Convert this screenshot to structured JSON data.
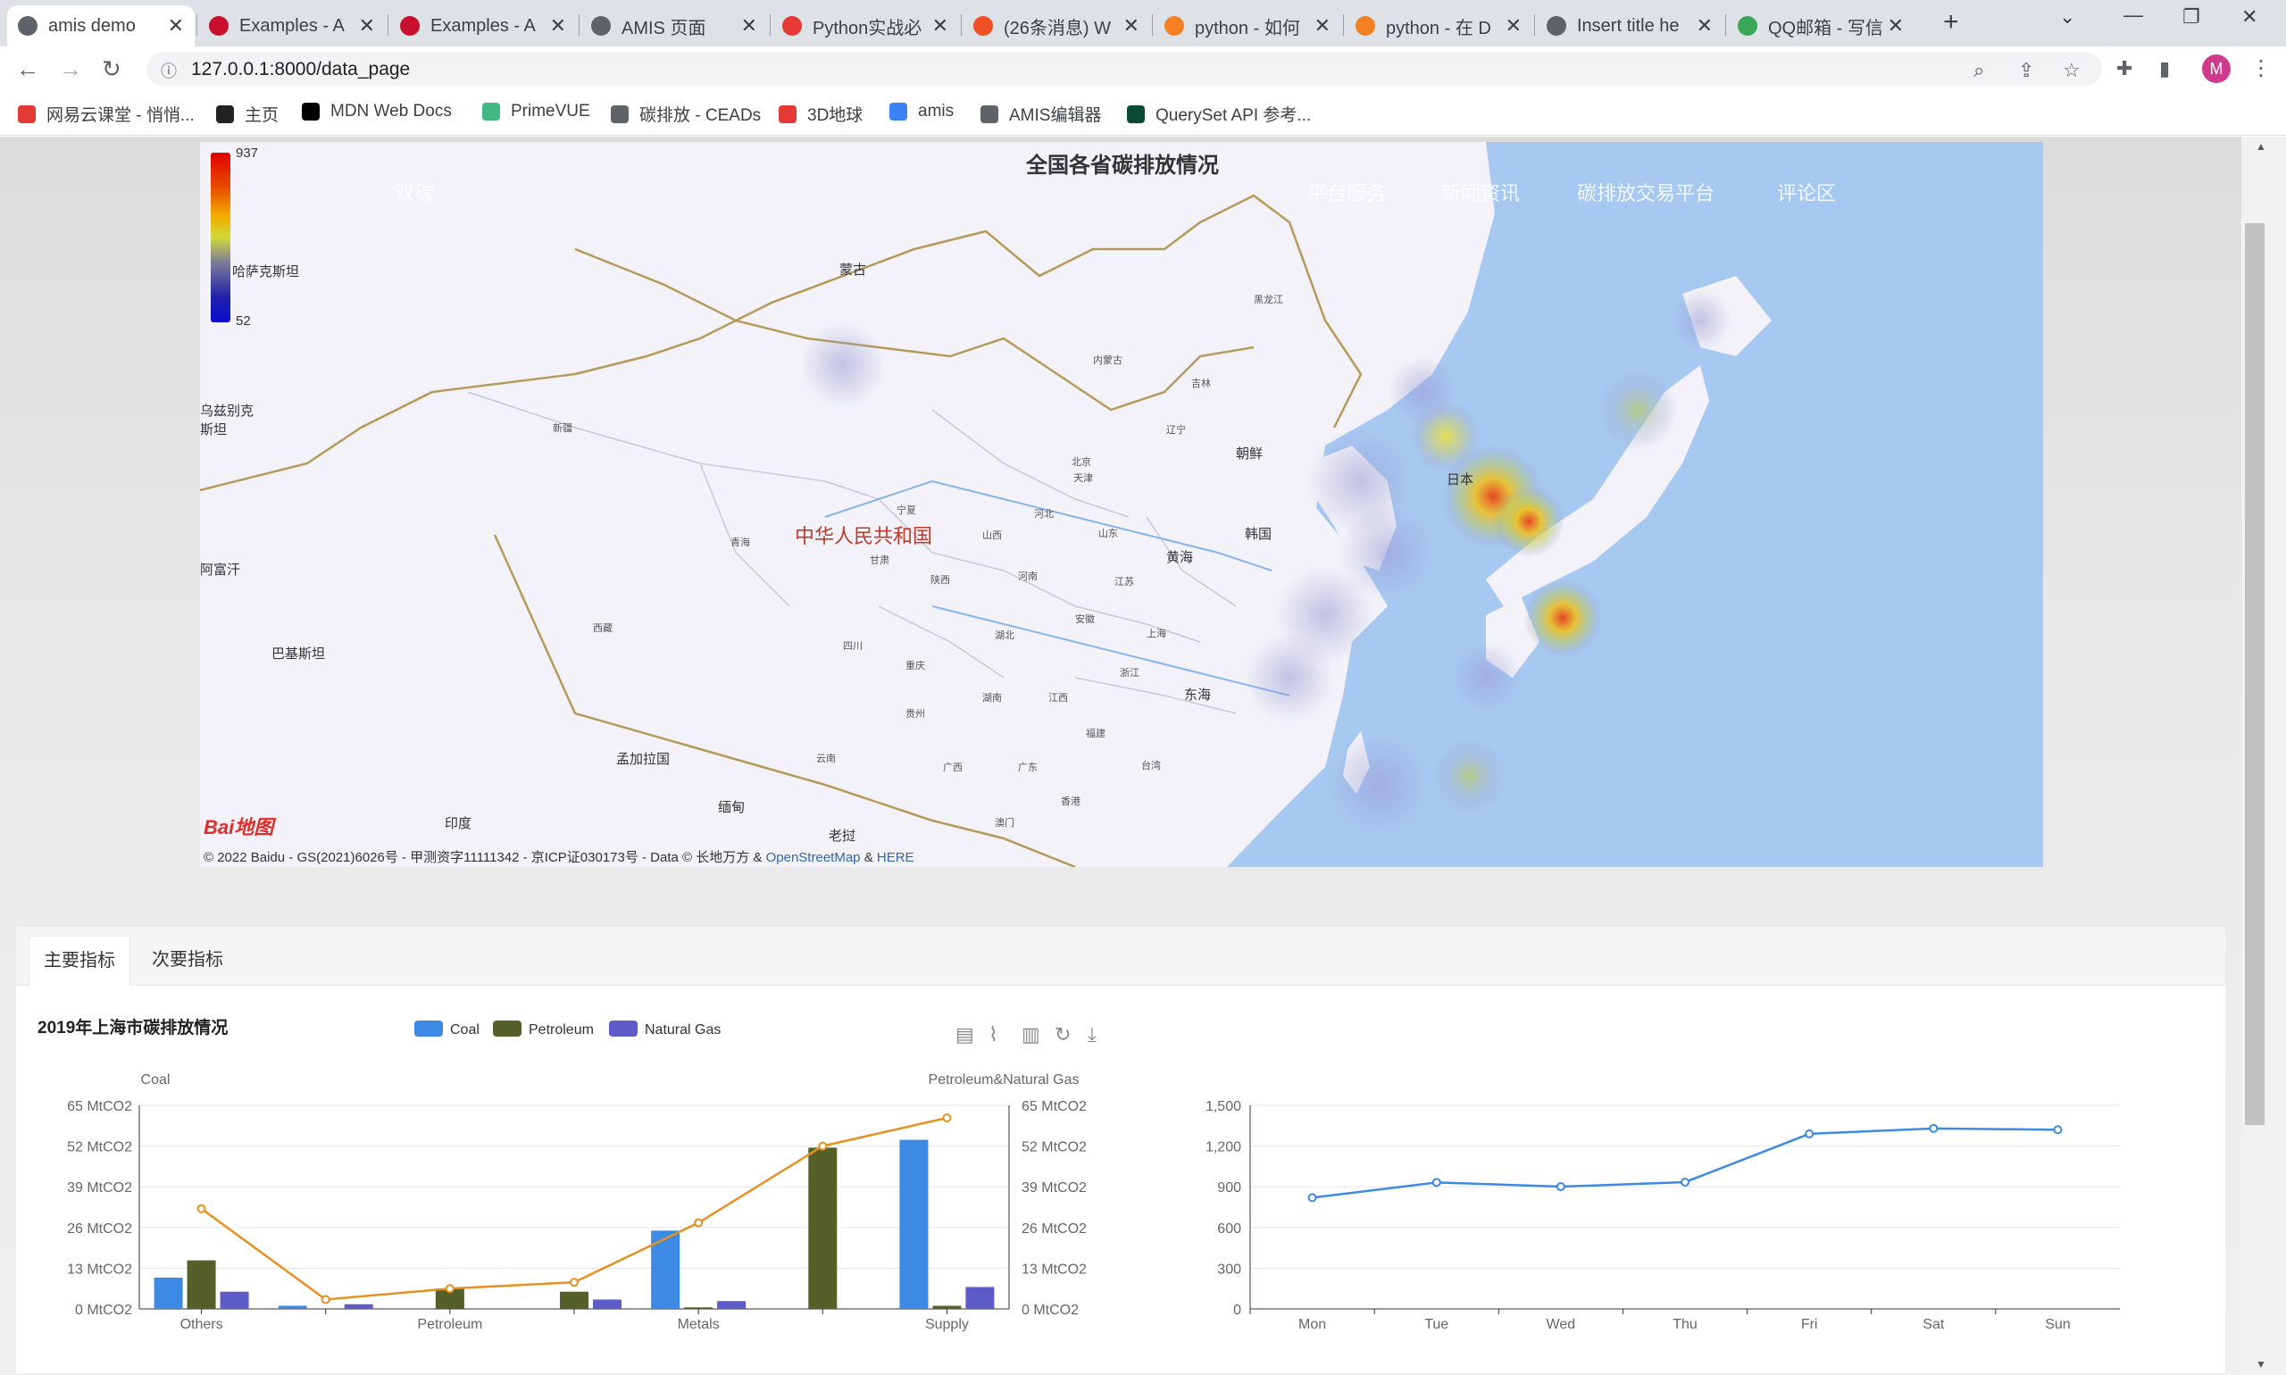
{
  "browser": {
    "tabs": [
      {
        "title": "amis demo",
        "active": true,
        "fav": "#5f6368"
      },
      {
        "title": "Examples - A",
        "active": false,
        "fav": "#c8102e"
      },
      {
        "title": "Examples - A",
        "active": false,
        "fav": "#c8102e"
      },
      {
        "title": "AMIS 页面",
        "active": false,
        "fav": "#5f6368"
      },
      {
        "title": "Python实战必",
        "active": false,
        "fav": "#e53935"
      },
      {
        "title": "(26条消息) W",
        "active": false,
        "fav": "#f04e23"
      },
      {
        "title": "python - 如何",
        "active": false,
        "fav": "#f48024"
      },
      {
        "title": "python - 在 D",
        "active": false,
        "fav": "#f48024"
      },
      {
        "title": "Insert title he",
        "active": false,
        "fav": "#5f6368"
      },
      {
        "title": "QQ邮箱 - 写信",
        "active": false,
        "fav": "#3aa657"
      }
    ],
    "url": "127.0.0.1:8000/data_page",
    "profile_initial": "M",
    "bookmarks": [
      {
        "label": "网易云课堂 - 悄悄...",
        "color": "#e53935"
      },
      {
        "label": "主页",
        "color": "#222222"
      },
      {
        "label": "MDN Web Docs",
        "color": "#000000"
      },
      {
        "label": "PrimeVUE",
        "color": "#41b883"
      },
      {
        "label": "碳排放 - CEADs",
        "color": "#5f6368"
      },
      {
        "label": "3D地球",
        "color": "#e53935"
      },
      {
        "label": "amis",
        "color": "#3b82f6"
      },
      {
        "label": "AMIS编辑器",
        "color": "#5f6368"
      },
      {
        "label": "QuerySet API 参考...",
        "color": "#0c4b33"
      }
    ]
  },
  "map": {
    "title": "全国各省碳排放情况",
    "nav_ghost": [
      "双碳",
      "平台服务",
      "新闻资讯",
      "碳排放交易平台",
      "评论区"
    ],
    "legend": {
      "max": "937",
      "min": "52"
    },
    "labels": {
      "mongolia": "蒙古",
      "china": "中华人民共和国",
      "north_korea": "朝鲜",
      "south_korea": "韩国",
      "japan": "日本",
      "kazakhstan": "哈萨克斯坦",
      "uzbekistan": "乌兹别克斯坦",
      "afghanistan": "阿富汗",
      "pakistan": "巴基斯坦",
      "bangladesh": "孟加拉国",
      "india": "印度",
      "myanmar": "缅甸",
      "laos": "老挝",
      "yellow_sea": "黄海",
      "east_sea": "东海"
    },
    "provinces": [
      "新疆",
      "西藏",
      "青海",
      "甘肃",
      "内蒙古",
      "黑龙江",
      "吉林",
      "辽宁",
      "天津",
      "北京",
      "河北",
      "山西",
      "山东",
      "陕西",
      "宁夏",
      "四川",
      "重庆",
      "湖北",
      "河南",
      "江苏",
      "安徽",
      "上海",
      "浙江",
      "江西",
      "湖南",
      "贵州",
      "云南",
      "广西",
      "广东",
      "福建",
      "台湾",
      "香港",
      "澳门"
    ],
    "copyright_prefix": "© 2022 Baidu - GS(2021)6026号 - 甲测资字11111342 - 京ICP证030173号 - Data © 长地万方 &",
    "copyright_link1": "OpenStreetMap",
    "copyright_amp": "&",
    "copyright_link2": "HERE",
    "baidu_logo": "Bai地图"
  },
  "panel": {
    "tabs": [
      "主要指标",
      "次要指标"
    ],
    "active_tab": 0
  },
  "chart_data": [
    {
      "type": "bar",
      "title": "2019年上海市碳排放情况",
      "categories": [
        "Others",
        "",
        "Petroleum",
        "",
        "Metals",
        "",
        "Supply"
      ],
      "category_axis_labels": [
        "Others",
        "Petroleum",
        "Metals",
        "Supply"
      ],
      "series": [
        {
          "name": "Coal",
          "type": "bar",
          "axis": "left",
          "color": "#3c8ae3",
          "values": [
            10,
            1,
            0,
            0,
            25,
            0,
            54
          ]
        },
        {
          "name": "Petroleum",
          "type": "bar",
          "axis": "left",
          "color": "#556029",
          "values": [
            15.5,
            0,
            6.5,
            5.5,
            0.5,
            51.5,
            1
          ]
        },
        {
          "name": "Natural Gas",
          "type": "bar",
          "axis": "left",
          "color": "#5c5bc8",
          "values": [
            5.5,
            1.5,
            0,
            3,
            2.5,
            0,
            7
          ]
        },
        {
          "name": "",
          "type": "line",
          "axis": "right",
          "color": "#e8901f",
          "values": [
            32,
            3,
            6.5,
            8.5,
            27.5,
            52,
            61
          ]
        }
      ],
      "yaxis_left": {
        "name": "Coal",
        "ticks": [
          "0 MtCO2",
          "13 MtCO2",
          "26 MtCO2",
          "39 MtCO2",
          "52 MtCO2",
          "65 MtCO2"
        ],
        "ylim": [
          0,
          65
        ]
      },
      "yaxis_right": {
        "name": "Petroleum&Natural Gas",
        "ticks": [
          "0 MtCO2",
          "13 MtCO2",
          "26 MtCO2",
          "39 MtCO2",
          "52 MtCO2",
          "65 MtCO2"
        ],
        "ylim": [
          0,
          65
        ]
      },
      "legend": [
        "Coal",
        "Petroleum",
        "Natural Gas"
      ],
      "legend_position": "top-center",
      "toolbox": [
        "data-view-icon",
        "line-chart-icon",
        "bar-chart-icon",
        "restore-icon",
        "download-icon"
      ],
      "grid": true
    },
    {
      "type": "line",
      "categories": [
        "Mon",
        "Tue",
        "Wed",
        "Thu",
        "Fri",
        "Sat",
        "Sun"
      ],
      "series": [
        {
          "name": "",
          "color": "#3c8ae3",
          "values": [
            820,
            932,
            901,
            934,
            1290,
            1330,
            1320
          ]
        }
      ],
      "yticks": [
        "0",
        "300",
        "600",
        "900",
        "1,200",
        "1,500"
      ],
      "ylim": [
        0,
        1500
      ],
      "grid": true
    }
  ]
}
